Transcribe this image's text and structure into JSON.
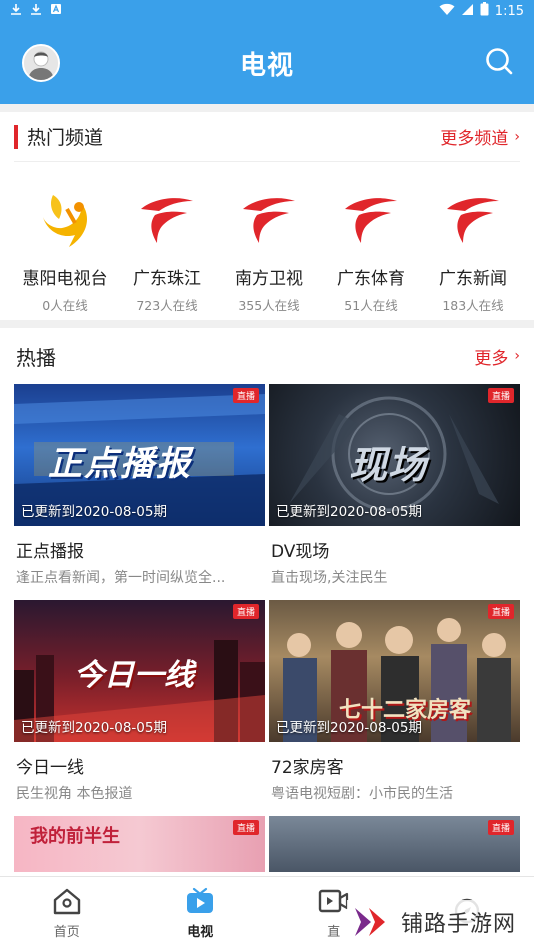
{
  "status_bar": {
    "time": "1:15"
  },
  "header": {
    "title": "电视"
  },
  "hot_channels": {
    "title": "热门频道",
    "more_label": "更多频道",
    "channels": [
      {
        "name": "惠阳电视台",
        "count": "0人在线"
      },
      {
        "name": "广东珠江",
        "count": "723人在线"
      },
      {
        "name": "南方卫视",
        "count": "355人在线"
      },
      {
        "name": "广东体育",
        "count": "51人在线"
      },
      {
        "name": "广东新闻",
        "count": "183人在线"
      }
    ]
  },
  "hot_play": {
    "title": "热播",
    "more_label": "更多",
    "live_tag": "直播",
    "items": [
      {
        "title": "正点播报",
        "desc": "逢正点看新闻，第一时间纵览全...",
        "update": "已更新到2020-08-05期",
        "thumb_text": "正点播报"
      },
      {
        "title": "DV现场",
        "desc": "直击现场,关注民生",
        "update": "已更新到2020-08-05期",
        "thumb_text": "现场"
      },
      {
        "title": "今日一线",
        "desc": "民生视角 本色报道",
        "update": "已更新到2020-08-05期",
        "thumb_text": "今日一线"
      },
      {
        "title": "72家房客",
        "desc": "粤语电视短剧：小市民的生活",
        "update": "已更新到2020-08-05期",
        "thumb_text": "七十二家房客"
      }
    ],
    "partial_thumb_text": "我的前半生"
  },
  "bottom_nav": {
    "items": [
      {
        "label": "首页",
        "icon": "home-icon"
      },
      {
        "label": "电视",
        "icon": "tv-icon"
      },
      {
        "label": "直",
        "icon": "live-video-icon"
      },
      {
        "label": "",
        "icon": "compass-icon"
      }
    ]
  },
  "watermark": {
    "text": "铺路手游网"
  },
  "colors": {
    "primary": "#3aa0ea",
    "accent": "#e0262b"
  }
}
